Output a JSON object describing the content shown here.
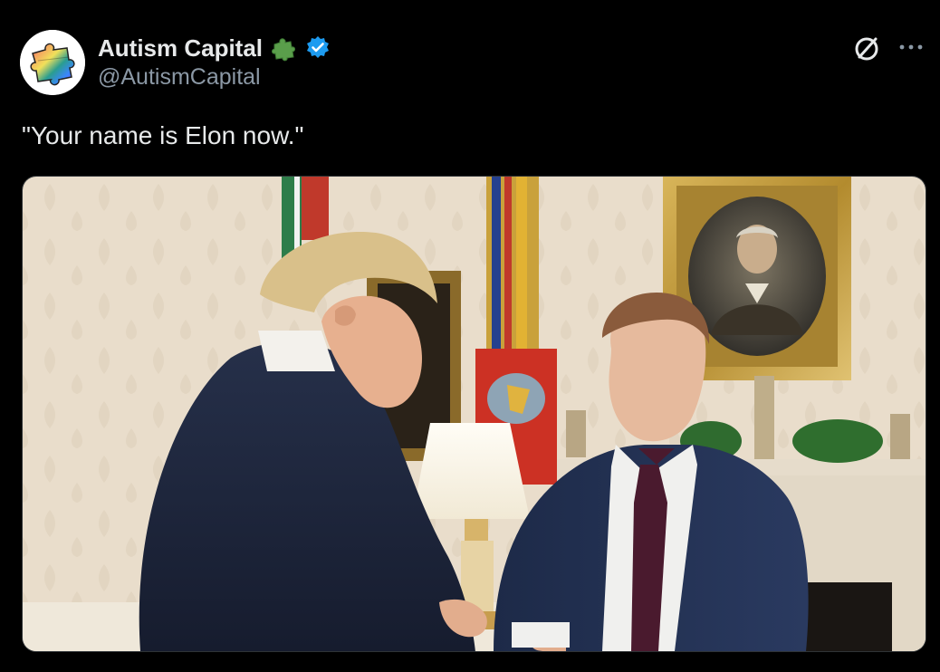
{
  "tweet": {
    "author": {
      "display_name": "Autism Capital",
      "handle": "@AutismCapital",
      "avatar_icon": "rainbow-puzzle-piece-icon",
      "name_emoji_icon": "green-puzzle-piece-icon",
      "verified_icon": "verified-badge-icon"
    },
    "text": "\"Your name is Elon now.\"",
    "actions": {
      "grok_icon": "grok-icon",
      "more_icon": "more-options-icon"
    },
    "media": {
      "type": "photo"
    }
  },
  "colors": {
    "background": "#000000",
    "text_primary": "#e7e9ea",
    "text_secondary": "#8b98a5",
    "verified_blue": "#1d9bf0"
  }
}
